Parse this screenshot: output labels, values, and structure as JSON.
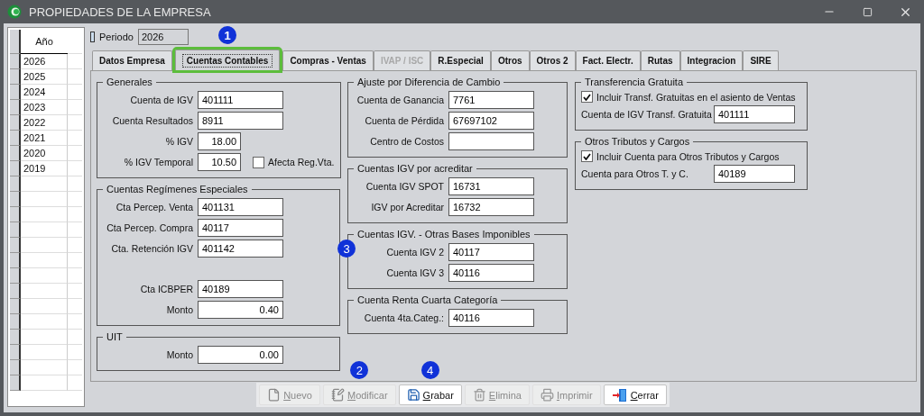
{
  "window": {
    "title": "PROPIEDADES DE LA EMPRESA"
  },
  "years": {
    "header": "Año",
    "rows": [
      "2026",
      "2025",
      "2024",
      "2023",
      "2022",
      "2021",
      "2020",
      "2019"
    ]
  },
  "periodo": {
    "label": "Periodo",
    "value": "2026"
  },
  "tabs": [
    {
      "label": "Datos Empresa",
      "selected": false,
      "disabled": false
    },
    {
      "label": "Cuentas Contables",
      "selected": true,
      "disabled": false,
      "badge": "1"
    },
    {
      "label": "Compras - Ventas",
      "selected": false,
      "disabled": false
    },
    {
      "label": "IVAP / ISC",
      "selected": false,
      "disabled": true
    },
    {
      "label": "R.Especial",
      "selected": false,
      "disabled": false
    },
    {
      "label": "Otros",
      "selected": false,
      "disabled": false
    },
    {
      "label": "Otros 2",
      "selected": false,
      "disabled": false
    },
    {
      "label": "Fact. Electr.",
      "selected": false,
      "disabled": false
    },
    {
      "label": "Rutas",
      "selected": false,
      "disabled": false
    },
    {
      "label": "Integracion",
      "selected": false,
      "disabled": false
    },
    {
      "label": "SIRE",
      "selected": false,
      "disabled": false
    }
  ],
  "columns": [
    [
      {
        "title": "Generales",
        "rows": [
          {
            "kind": "field",
            "label": "Cuenta de IGV",
            "value": "401111"
          },
          {
            "kind": "field",
            "label": "Cuenta Resultados",
            "value": "8911"
          },
          {
            "kind": "number",
            "label": "% IGV",
            "value": "18.00"
          },
          {
            "kind": "number",
            "label": "% IGV Temporal",
            "value": "10.50",
            "check": {
              "label": "Afecta Reg.Vta.",
              "checked": false
            }
          }
        ]
      },
      {
        "title": "Cuentas Regímenes Especiales",
        "rows": [
          {
            "kind": "field",
            "label": "Cta Percep. Venta",
            "value": "401131"
          },
          {
            "kind": "field",
            "label": "Cta Percep. Compra",
            "value": "40117"
          },
          {
            "kind": "field",
            "label": "Cta. Retención IGV",
            "value": "401142",
            "badge": "3"
          },
          {
            "kind": "field",
            "label": "Cta ICBPER",
            "value": "40189",
            "separated": true
          },
          {
            "kind": "amount",
            "label": "Monto",
            "value": "0.40"
          }
        ]
      },
      {
        "title": "UIT",
        "rows": [
          {
            "kind": "amount",
            "label": "Monto",
            "value": "0.00"
          }
        ]
      }
    ],
    [
      {
        "title": "Ajuste por Diferencia de Cambio",
        "rows": [
          {
            "kind": "field",
            "label": "Cuenta de Ganancia",
            "value": "7761"
          },
          {
            "kind": "field",
            "label": "Cuenta de Pérdida",
            "value": "67697102"
          },
          {
            "kind": "field",
            "label": "Centro de Costos"
          }
        ]
      },
      {
        "title": "Cuentas IGV por acreditar",
        "rows": [
          {
            "kind": "field",
            "label": "Cuenta IGV SPOT",
            "value": "16731"
          },
          {
            "kind": "field",
            "label": "IGV por Acreditar",
            "value": "16732"
          }
        ]
      },
      {
        "title": "Cuentas IGV. - Otras Bases Imponibles",
        "rows": [
          {
            "kind": "field",
            "label": "Cuenta IGV 2",
            "value": "40117"
          },
          {
            "kind": "field",
            "label": "Cuenta IGV 3",
            "value": "40116"
          }
        ]
      },
      {
        "title": "Cuenta Renta Cuarta Categoría",
        "rows": [
          {
            "kind": "field",
            "label": "Cuenta 4ta.Categ.:",
            "value": "40116"
          }
        ]
      }
    ],
    [
      {
        "title": "Transferencia Gratuita",
        "rows": [
          {
            "kind": "checkbox",
            "label": "Incluir Transf. Gratuitas en el asiento de Ventas",
            "checked": true
          },
          {
            "kind": "field",
            "label": "Cuenta de IGV Transf. Gratuita",
            "value": "401111"
          }
        ]
      },
      {
        "title": "Otros Tributos y Cargos",
        "rows": [
          {
            "kind": "checkbox",
            "label": "Incluir Cuenta para Otros Tributos y Cargos",
            "checked": true
          },
          {
            "kind": "field",
            "label": "Cuenta para Otros T. y C.",
            "value": "40189"
          }
        ]
      }
    ]
  ],
  "buttons": [
    {
      "kind": "new",
      "label": "Nuevo",
      "disabled": true
    },
    {
      "kind": "edit",
      "label": "Modificar",
      "disabled": true,
      "badge": "2"
    },
    {
      "kind": "save",
      "label": "Grabar",
      "disabled": false,
      "badge": "4"
    },
    {
      "kind": "delete",
      "label": "Elimina",
      "disabled": true
    },
    {
      "kind": "print",
      "label": "Imprimir",
      "disabled": true
    },
    {
      "kind": "close",
      "label": "Cerrar",
      "disabled": false
    }
  ]
}
